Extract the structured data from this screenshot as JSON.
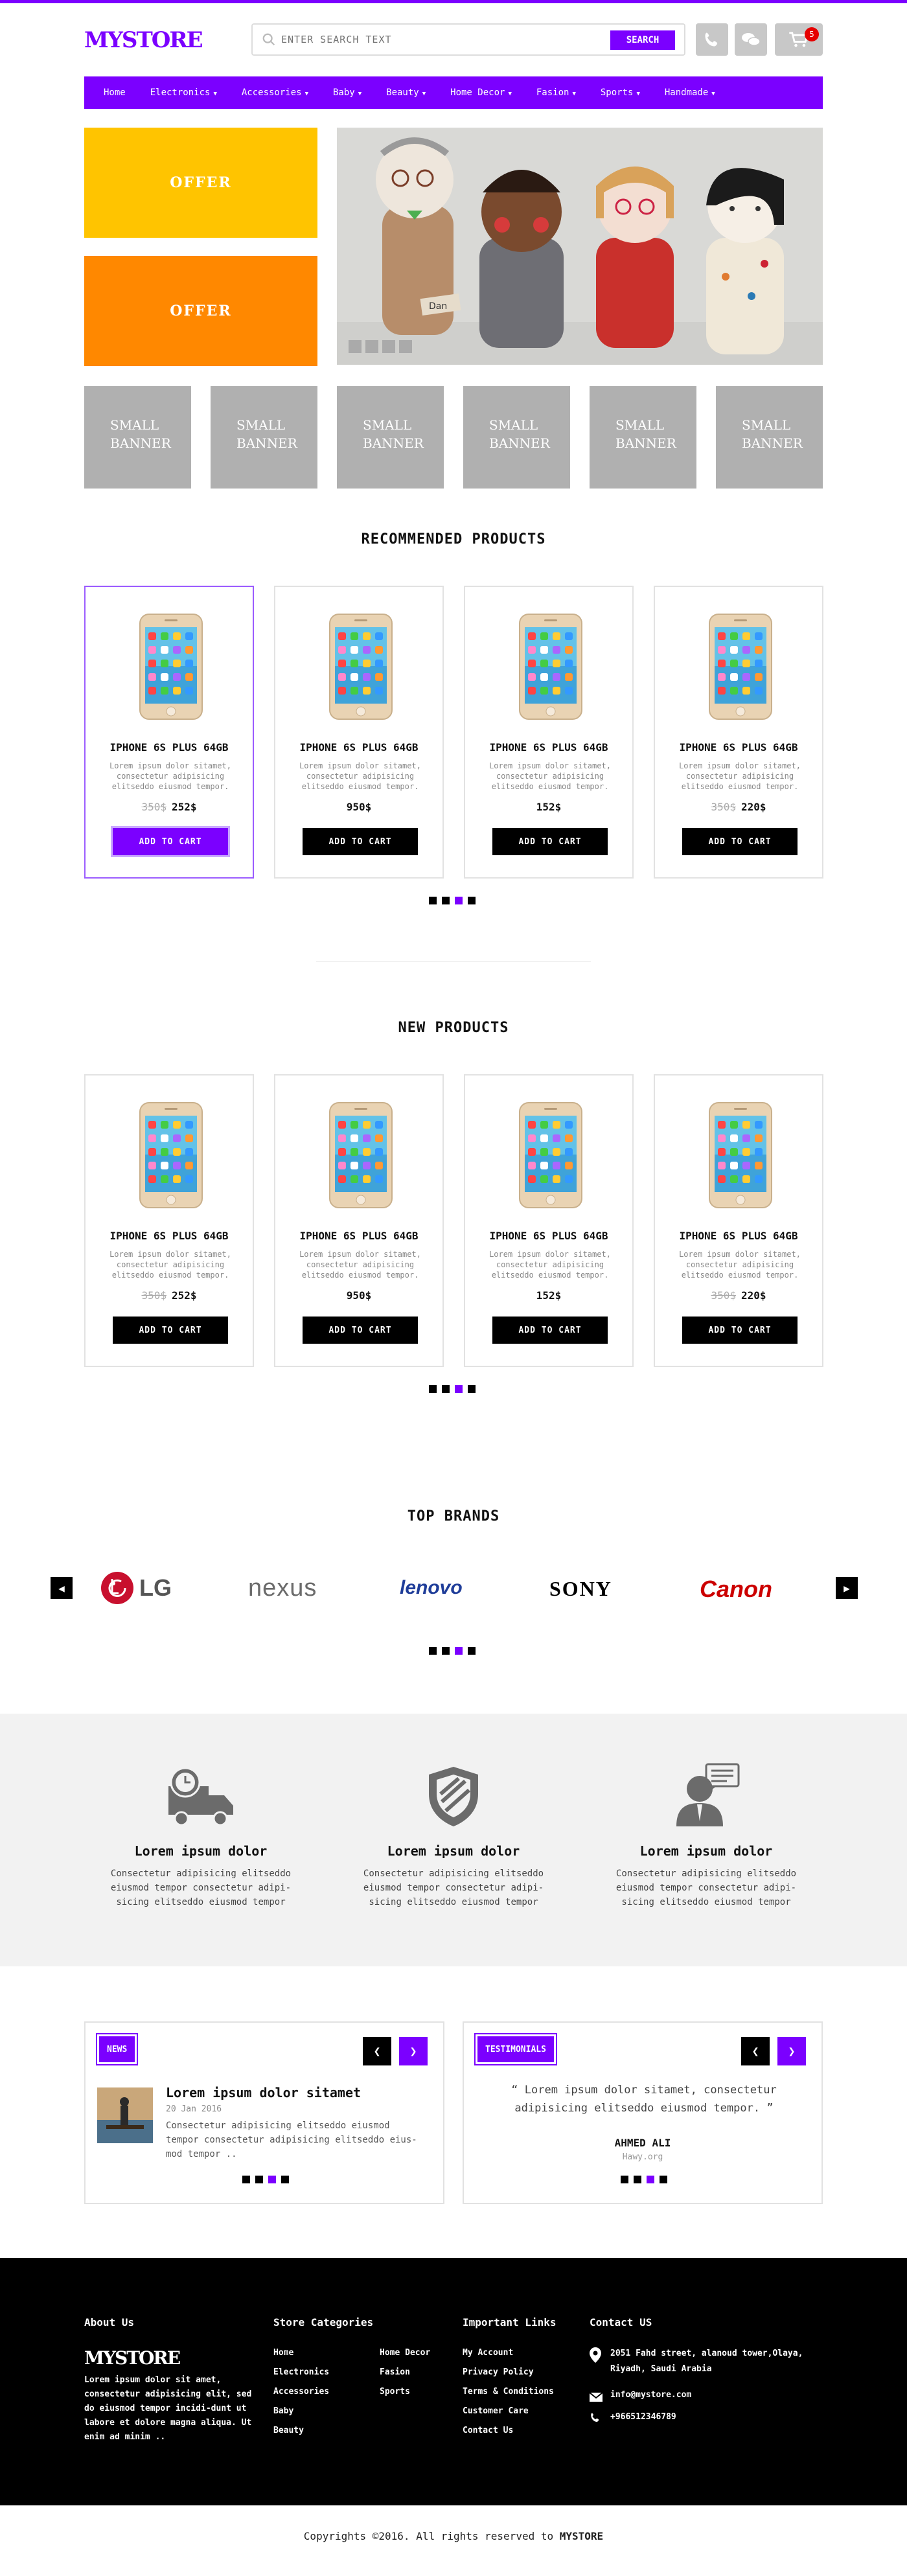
{
  "brand": {
    "logo": "MYSTORE"
  },
  "search": {
    "placeholder": "ENTER SEARCH TEXT",
    "button": "SEARCH"
  },
  "header": {
    "cart_count": "5"
  },
  "nav": {
    "items": [
      {
        "label": "Home",
        "dropdown": false
      },
      {
        "label": "Electronics",
        "dropdown": true
      },
      {
        "label": "Accessories",
        "dropdown": true
      },
      {
        "label": "Baby",
        "dropdown": true
      },
      {
        "label": "Beauty",
        "dropdown": true
      },
      {
        "label": "Home Decor",
        "dropdown": true
      },
      {
        "label": "Fasion",
        "dropdown": true
      },
      {
        "label": "Sports",
        "dropdown": true
      },
      {
        "label": "Handmade",
        "dropdown": true
      }
    ]
  },
  "hero": {
    "offer_1": "OFFER",
    "offer_2": "OFFER",
    "offer_colors": [
      "#ffc400",
      "#ff8800"
    ],
    "slide_tag": "Dan"
  },
  "small_banners": [
    "SMALL BANNER",
    "SMALL BANNER",
    "SMALL BANNER",
    "SMALL BANNER",
    "SMALL BANNER",
    "SMALL BANNER"
  ],
  "recommended": {
    "title": "RECOMMENDED PRODUCTS",
    "products": [
      {
        "name": "IPHONE 6S PLUS 64GB",
        "desc": "Lorem ipsum dolor sitamet, consectetur adipisicing elitseddo eiusmod tempor.",
        "old_price": "350$",
        "price": "252$",
        "button": "ADD TO CART"
      },
      {
        "name": "IPHONE 6S PLUS 64GB",
        "desc": "Lorem ipsum dolor sitamet, consectetur adipisicing elitseddo eiusmod tempor.",
        "old_price": "",
        "price": "950$",
        "button": "ADD TO CART"
      },
      {
        "name": "IPHONE 6S PLUS 64GB",
        "desc": "Lorem ipsum dolor sitamet, consectetur adipisicing elitseddo eiusmod tempor.",
        "old_price": "",
        "price": "152$",
        "button": "ADD TO CART"
      },
      {
        "name": "IPHONE 6S PLUS 64GB",
        "desc": "Lorem ipsum dolor sitamet, consectetur adipisicing elitseddo eiusmod tempor.",
        "old_price": "350$",
        "price": "220$",
        "button": "ADD TO CART"
      }
    ]
  },
  "new_products": {
    "title": "NEW PRODUCTS",
    "products": [
      {
        "name": "IPHONE 6S PLUS 64GB",
        "desc": "Lorem ipsum dolor sitamet, consectetur adipisicing elitseddo eiusmod tempor.",
        "old_price": "350$",
        "price": "252$",
        "button": "ADD TO CART"
      },
      {
        "name": "IPHONE 6S PLUS 64GB",
        "desc": "Lorem ipsum dolor sitamet, consectetur adipisicing elitseddo eiusmod tempor.",
        "old_price": "",
        "price": "950$",
        "button": "ADD TO CART"
      },
      {
        "name": "IPHONE 6S PLUS 64GB",
        "desc": "Lorem ipsum dolor sitamet, consectetur adipisicing elitseddo eiusmod tempor.",
        "old_price": "",
        "price": "152$",
        "button": "ADD TO CART"
      },
      {
        "name": "IPHONE 6S PLUS 64GB",
        "desc": "Lorem ipsum dolor sitamet, consectetur adipisicing elitseddo eiusmod tempor.",
        "old_price": "350$",
        "price": "220$",
        "button": "ADD TO CART"
      }
    ]
  },
  "brands": {
    "title": "TOP BRANDS",
    "logos": [
      "LG",
      "nexus",
      "lenovo",
      "SONY",
      "Canon"
    ]
  },
  "features": [
    {
      "icon": "delivery-truck-icon",
      "title": "Lorem ipsum dolor",
      "text": "Consectetur adipisicing elitseddo eiusmod tempor consectetur adipi-sicing elitseddo eiusmod tempor"
    },
    {
      "icon": "shield-icon",
      "title": "Lorem ipsum dolor",
      "text": "Consectetur adipisicing elitseddo eiusmod tempor consectetur adipi-sicing elitseddo eiusmod tempor"
    },
    {
      "icon": "support-agent-icon",
      "title": "Lorem ipsum dolor",
      "text": "Consectetur adipisicing elitseddo eiusmod tempor consectetur adipi-sicing elitseddo eiusmod tempor"
    }
  ],
  "news": {
    "tag": "NEWS",
    "title": "Lorem ipsum dolor sitamet",
    "date": "20 Jan 2016",
    "text": "Consectetur adipisicing elitseddo eiusmod tempor consectetur adipisicing elitseddo eius-mod tempor .."
  },
  "testimonials": {
    "tag": "TESTIMONIALS",
    "quote": "“ Lorem ipsum dolor sitamet, consectetur adipisicing elitseddo eiusmod tempor. ”",
    "author": "AHMED ALI",
    "site": "Hawy.org"
  },
  "footer": {
    "about_title": "About Us",
    "about_logo": "MYSTORE",
    "about_text": "Lorem ipsum dolor sit amet, consectetur adipisicing elit, sed do eiusmod tempor incidi-dunt ut labore et dolore magna aliqua. Ut enim ad minim ..",
    "categories_title": "Store Categories",
    "categories_col1": [
      "Home",
      "Electronics",
      "Accessories",
      "Baby",
      "Beauty"
    ],
    "categories_col2": [
      "Home Decor",
      "Fasion",
      "Sports"
    ],
    "links_title": "Important Links",
    "links": [
      "My Account",
      "Privacy Policy",
      "Terms & Conditions",
      "Customer Care",
      "Contact Us"
    ],
    "contact_title": "Contact US",
    "address": "2051 Fahd street, alanoud tower,Olaya, Riyadh, Saudi Arabia",
    "email": "info@mystore.com",
    "phone": "+966512346789"
  },
  "copyright": {
    "text": "Copyrights ©2016. All rights reserved to ",
    "brand": "MYSTORE"
  },
  "colors": {
    "accent": "#7b00ff",
    "offer_yellow": "#ffc400",
    "offer_orange": "#ff8800",
    "badge": "#e60000"
  }
}
